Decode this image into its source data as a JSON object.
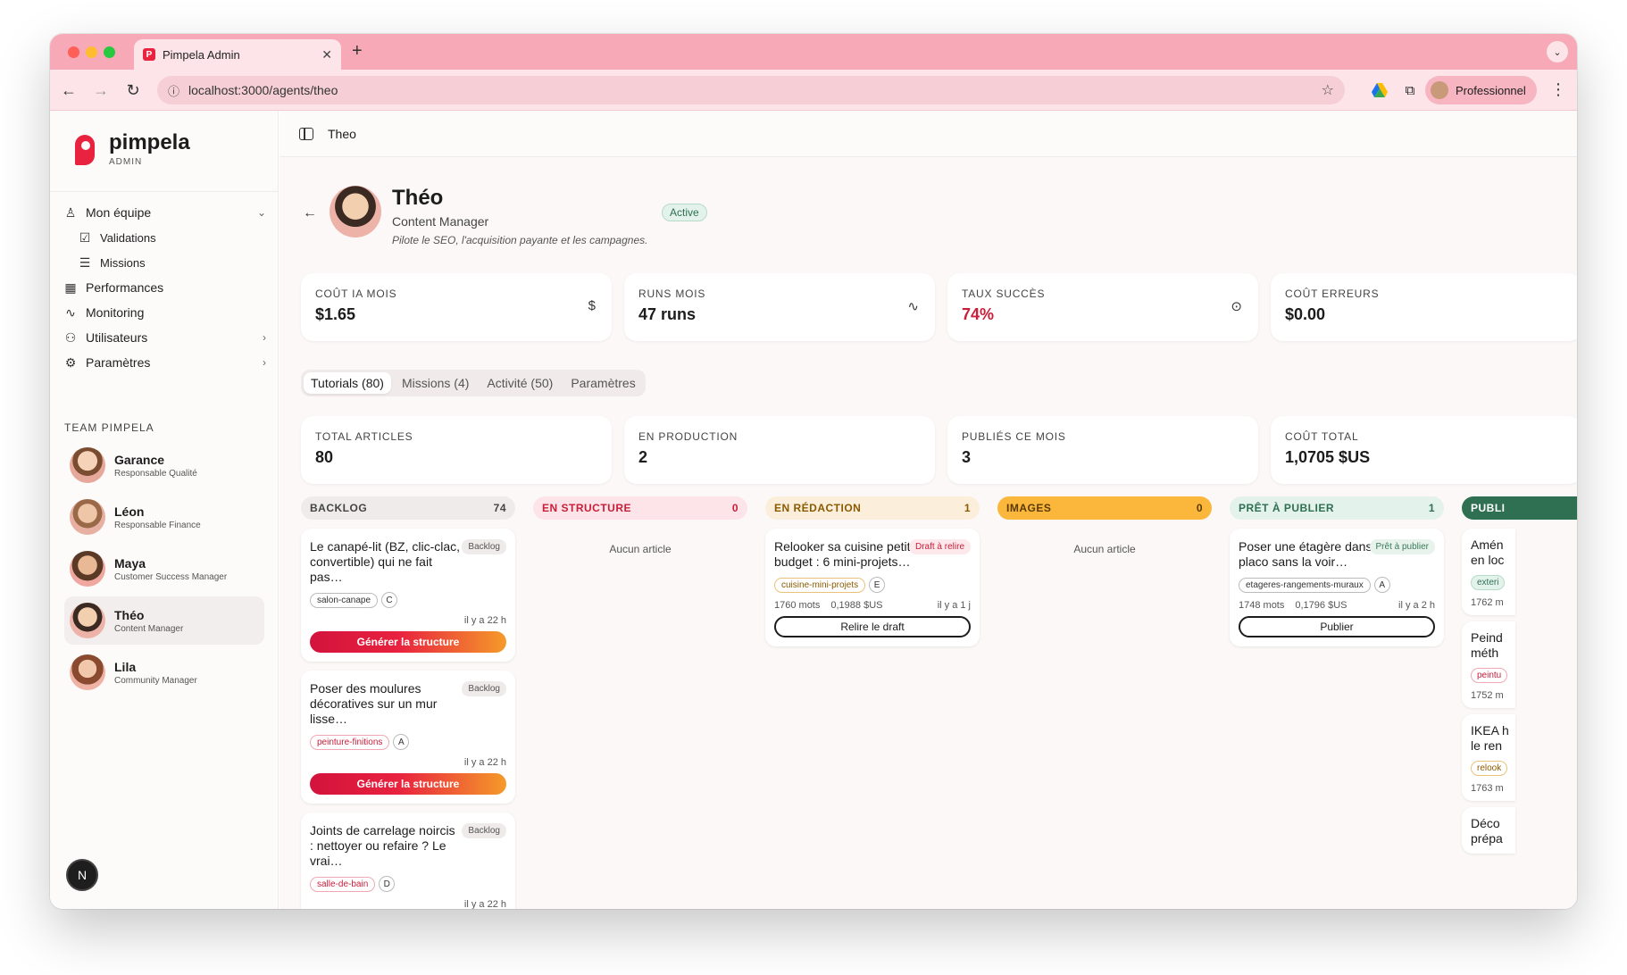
{
  "browser": {
    "tab_title": "Pimpela Admin",
    "tab_favicon": "P",
    "url": "localhost:3000/agents/theo",
    "profile_label": "Professionnel"
  },
  "sidebar": {
    "brand_name": "pimpela",
    "brand_sub": "ADMIN",
    "nav": [
      {
        "label": "Mon équipe",
        "icon": "team-icon"
      },
      {
        "label": "Validations",
        "icon": "check-square-icon"
      },
      {
        "label": "Missions",
        "icon": "list-checks-icon"
      },
      {
        "label": "Performances",
        "icon": "grid-icon"
      },
      {
        "label": "Monitoring",
        "icon": "activity-icon"
      },
      {
        "label": "Utilisateurs",
        "icon": "users-icon"
      },
      {
        "label": "Paramètres",
        "icon": "gear-icon"
      }
    ],
    "team_title": "TEAM PIMPELA",
    "team": [
      {
        "name": "Garance",
        "role": "Responsable Qualité"
      },
      {
        "name": "Léon",
        "role": "Responsable Finance"
      },
      {
        "name": "Maya",
        "role": "Customer Success Manager"
      },
      {
        "name": "Théo",
        "role": "Content Manager"
      },
      {
        "name": "Lila",
        "role": "Community Manager"
      }
    ],
    "fab_label": "N"
  },
  "topbar": {
    "breadcrumb": "Theo"
  },
  "agent": {
    "name": "Théo",
    "role": "Content Manager",
    "description": "Pilote le SEO, l'acquisition payante et les campagnes.",
    "status": "Active"
  },
  "kpis_top": [
    {
      "label": "COÛT IA MOIS",
      "value": "$1.65",
      "icon": "dollar-icon"
    },
    {
      "label": "RUNS MOIS",
      "value": "47 runs",
      "icon": "activity-icon"
    },
    {
      "label": "TAUX SUCCÈS",
      "value": "74%",
      "icon": "check-circle-icon"
    },
    {
      "label": "COÛT ERREURS",
      "value": "$0.00",
      "icon": ""
    }
  ],
  "tabs": [
    "Tutorials (80)",
    "Missions (4)",
    "Activité (50)",
    "Paramètres"
  ],
  "kpis_articles": [
    {
      "label": "TOTAL ARTICLES",
      "value": "80"
    },
    {
      "label": "EN PRODUCTION",
      "value": "2"
    },
    {
      "label": "PUBLIÉS CE MOIS",
      "value": "3"
    },
    {
      "label": "COÛT TOTAL",
      "value": "1,0705 $US"
    }
  ],
  "kanban": {
    "empty_label": "Aucun article",
    "columns": [
      {
        "title": "BACKLOG",
        "count": "74",
        "bg": "#efebeb",
        "fg": "#444444"
      },
      {
        "title": "EN STRUCTURE",
        "count": "0",
        "bg": "#fde4e8",
        "fg": "#c81e3a"
      },
      {
        "title": "EN RÉDACTION",
        "count": "1",
        "bg": "#fbefdc",
        "fg": "#8a5a00"
      },
      {
        "title": "IMAGES",
        "count": "0",
        "bg": "#fbb73c",
        "fg": "#5a3a00"
      },
      {
        "title": "PRÊT À PUBLIER",
        "count": "1",
        "bg": "#e3f2ea",
        "fg": "#2f6f52"
      },
      {
        "title": "PUBLI",
        "count": "",
        "bg": "#2f6f52",
        "fg": "#ffffff"
      }
    ],
    "backlog_cards": [
      {
        "title": "Le canapé-lit (BZ, clic-clac, convertible) qui ne fait pas…",
        "status": "Backlog",
        "tag": "salon-canape",
        "grade": "C",
        "time": "il y a 22 h",
        "action": "Générer la structure"
      },
      {
        "title": "Poser des moulures décoratives sur un mur lisse…",
        "status": "Backlog",
        "tag": "peinture-finitions",
        "grade": "A",
        "time": "il y a 22 h",
        "action": "Générer la structure"
      },
      {
        "title": "Joints de carrelage noircis : nettoyer ou refaire ? Le vrai…",
        "status": "Backlog",
        "tag": "salle-de-bain",
        "grade": "D",
        "time": "il y a 22 h",
        "action": ""
      }
    ],
    "redaction_card": {
      "title": "Relooker sa cuisine petit budget : 6 mini-projets…",
      "status": "Draft à relire",
      "tag": "cuisine-mini-projets",
      "grade": "E",
      "words": "1760 mots",
      "cost": "0,1988 $US",
      "time": "il y a 1 j",
      "action": "Relire le draft"
    },
    "pret_card": {
      "title": "Poser une étagère dans du placo sans la voir…",
      "status": "Prêt à publier",
      "tag": "etageres-rangements-muraux",
      "grade": "A",
      "words": "1748 mots",
      "cost": "0,1796 $US",
      "time": "il y a 2 h",
      "action": "Publier"
    },
    "publie_cards": [
      {
        "title1": "Amén",
        "title2": "en loc",
        "tag": "exteri",
        "meta": "1762 m"
      },
      {
        "title1": "Peind",
        "title2": "méth",
        "tag": "peintu",
        "meta": "1752 m"
      },
      {
        "title1": "IKEA h",
        "title2": "le ren",
        "tag": "relook",
        "meta": "1763 m"
      },
      {
        "title1": "Déco",
        "title2": "prépa",
        "tag": "",
        "meta": ""
      }
    ]
  }
}
